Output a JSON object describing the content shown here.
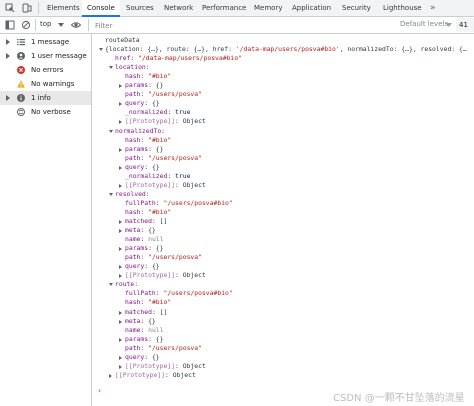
{
  "tabs": [
    {
      "label": "Elements"
    },
    {
      "label": "Console"
    },
    {
      "label": "Sources"
    },
    {
      "label": "Network"
    },
    {
      "label": "Performance"
    },
    {
      "label": "Memory"
    },
    {
      "label": "Application"
    },
    {
      "label": "Security"
    },
    {
      "label": "Lighthouse"
    }
  ],
  "active_tab": "Console",
  "more_tabs": "»",
  "toolbar": {
    "context": "top",
    "filter_placeholder": "Filter",
    "levels": "Default levels",
    "issues_count": "41"
  },
  "sidebar": {
    "items": [
      {
        "label": "1 message",
        "icon": "list-icon"
      },
      {
        "label": "1 user message",
        "icon": "user-icon"
      },
      {
        "label": "No errors",
        "icon": "error-icon"
      },
      {
        "label": "No warnings",
        "icon": "warning-icon"
      },
      {
        "label": "1 info",
        "icon": "info-icon"
      },
      {
        "label": "No verbose",
        "icon": "verbose-icon"
      }
    ],
    "selected_index": 4
  },
  "console": {
    "lines": [
      {
        "indent": 0,
        "tri": "",
        "text": [
          [
            "p",
            "routeData"
          ]
        ]
      },
      {
        "indent": 0,
        "tri": "down",
        "text": [
          [
            "p",
            "{location: {…}, route: {…}, href: "
          ],
          [
            "s",
            "'/data-map/users/posva#bio'"
          ],
          [
            "p",
            ", normalizedTo: {…}, resolved: {…"
          ]
        ]
      },
      {
        "indent": 1,
        "tri": "",
        "text": [
          [
            "k",
            "href"
          ],
          [
            "p",
            ": "
          ],
          [
            "s",
            "\"/data-map/users/posva#bio\""
          ]
        ]
      },
      {
        "indent": 1,
        "tri": "down",
        "text": [
          [
            "k",
            "location"
          ],
          [
            "p",
            ":"
          ]
        ]
      },
      {
        "indent": 2,
        "tri": "",
        "text": [
          [
            "k",
            "hash"
          ],
          [
            "p",
            ": "
          ],
          [
            "s",
            "\"#bio\""
          ]
        ]
      },
      {
        "indent": 2,
        "tri": "right",
        "text": [
          [
            "k",
            "params"
          ],
          [
            "p",
            ": {}"
          ]
        ]
      },
      {
        "indent": 2,
        "tri": "",
        "text": [
          [
            "k",
            "path"
          ],
          [
            "p",
            ": "
          ],
          [
            "s",
            "\"/users/posva\""
          ]
        ]
      },
      {
        "indent": 2,
        "tri": "right",
        "text": [
          [
            "k",
            "query"
          ],
          [
            "p",
            ": {}"
          ]
        ]
      },
      {
        "indent": 2,
        "tri": "",
        "text": [
          [
            "k",
            "_normalized"
          ],
          [
            "p",
            ": "
          ],
          [
            "n",
            "true"
          ]
        ]
      },
      {
        "indent": 2,
        "tri": "right",
        "text": [
          [
            "k dim",
            "[[Prototype]]"
          ],
          [
            "p",
            ": Object"
          ]
        ]
      },
      {
        "indent": 1,
        "tri": "down",
        "text": [
          [
            "k",
            "normalizedTo"
          ],
          [
            "p",
            ":"
          ]
        ]
      },
      {
        "indent": 2,
        "tri": "",
        "text": [
          [
            "k",
            "hash"
          ],
          [
            "p",
            ": "
          ],
          [
            "s",
            "\"#bio\""
          ]
        ]
      },
      {
        "indent": 2,
        "tri": "right",
        "text": [
          [
            "k",
            "params"
          ],
          [
            "p",
            ": {}"
          ]
        ]
      },
      {
        "indent": 2,
        "tri": "",
        "text": [
          [
            "k",
            "path"
          ],
          [
            "p",
            ": "
          ],
          [
            "s",
            "\"/users/posva\""
          ]
        ]
      },
      {
        "indent": 2,
        "tri": "right",
        "text": [
          [
            "k",
            "query"
          ],
          [
            "p",
            ": {}"
          ]
        ]
      },
      {
        "indent": 2,
        "tri": "",
        "text": [
          [
            "k",
            "_normalized"
          ],
          [
            "p",
            ": "
          ],
          [
            "n",
            "true"
          ]
        ]
      },
      {
        "indent": 2,
        "tri": "right",
        "text": [
          [
            "k dim",
            "[[Prototype]]"
          ],
          [
            "p",
            ": Object"
          ]
        ]
      },
      {
        "indent": 1,
        "tri": "down",
        "text": [
          [
            "k",
            "resolved"
          ],
          [
            "p",
            ":"
          ]
        ]
      },
      {
        "indent": 2,
        "tri": "",
        "text": [
          [
            "k",
            "fullPath"
          ],
          [
            "p",
            ": "
          ],
          [
            "s",
            "\"/users/posva#bio\""
          ]
        ]
      },
      {
        "indent": 2,
        "tri": "",
        "text": [
          [
            "k",
            "hash"
          ],
          [
            "p",
            ": "
          ],
          [
            "s",
            "\"#bio\""
          ]
        ]
      },
      {
        "indent": 2,
        "tri": "right",
        "text": [
          [
            "k",
            "matched"
          ],
          [
            "p",
            ": []"
          ]
        ]
      },
      {
        "indent": 2,
        "tri": "right",
        "text": [
          [
            "k",
            "meta"
          ],
          [
            "p",
            ": {}"
          ]
        ]
      },
      {
        "indent": 2,
        "tri": "",
        "text": [
          [
            "k",
            "name"
          ],
          [
            "p",
            ": "
          ],
          [
            "nul",
            "null"
          ]
        ]
      },
      {
        "indent": 2,
        "tri": "right",
        "text": [
          [
            "k",
            "params"
          ],
          [
            "p",
            ": {}"
          ]
        ]
      },
      {
        "indent": 2,
        "tri": "",
        "text": [
          [
            "k",
            "path"
          ],
          [
            "p",
            ": "
          ],
          [
            "s",
            "\"/users/posva\""
          ]
        ]
      },
      {
        "indent": 2,
        "tri": "right",
        "text": [
          [
            "k",
            "query"
          ],
          [
            "p",
            ": {}"
          ]
        ]
      },
      {
        "indent": 2,
        "tri": "right",
        "text": [
          [
            "k dim",
            "[[Prototype]]"
          ],
          [
            "p",
            ": Object"
          ]
        ]
      },
      {
        "indent": 1,
        "tri": "down",
        "text": [
          [
            "k",
            "route"
          ],
          [
            "p",
            ":"
          ]
        ]
      },
      {
        "indent": 2,
        "tri": "",
        "text": [
          [
            "k",
            "fullPath"
          ],
          [
            "p",
            ": "
          ],
          [
            "s",
            "\"/users/posva#bio\""
          ]
        ]
      },
      {
        "indent": 2,
        "tri": "",
        "text": [
          [
            "k",
            "hash"
          ],
          [
            "p",
            ": "
          ],
          [
            "s",
            "\"#bio\""
          ]
        ]
      },
      {
        "indent": 2,
        "tri": "right",
        "text": [
          [
            "k",
            "matched"
          ],
          [
            "p",
            ": []"
          ]
        ]
      },
      {
        "indent": 2,
        "tri": "right",
        "text": [
          [
            "k",
            "meta"
          ],
          [
            "p",
            ": {}"
          ]
        ]
      },
      {
        "indent": 2,
        "tri": "",
        "text": [
          [
            "k",
            "name"
          ],
          [
            "p",
            ": "
          ],
          [
            "nul",
            "null"
          ]
        ]
      },
      {
        "indent": 2,
        "tri": "right",
        "text": [
          [
            "k",
            "params"
          ],
          [
            "p",
            ": {}"
          ]
        ]
      },
      {
        "indent": 2,
        "tri": "",
        "text": [
          [
            "k",
            "path"
          ],
          [
            "p",
            ": "
          ],
          [
            "s",
            "\"/users/posva\""
          ]
        ]
      },
      {
        "indent": 2,
        "tri": "right",
        "text": [
          [
            "k",
            "query"
          ],
          [
            "p",
            ": {}"
          ]
        ]
      },
      {
        "indent": 2,
        "tri": "right",
        "text": [
          [
            "k dim",
            "[[Prototype]]"
          ],
          [
            "p",
            ": Object"
          ]
        ]
      },
      {
        "indent": 1,
        "tri": "right",
        "text": [
          [
            "k dim",
            "[[Prototype]]"
          ],
          [
            "p",
            ": Object"
          ]
        ]
      }
    ],
    "prompt": "›"
  },
  "watermark": "CSDN @一颗不甘坠落的流星",
  "colors": {
    "accent": "#1a73e8",
    "key": "#881391",
    "string": "#c41a16",
    "boolean": "#0d22aa",
    "null": "#80868b",
    "error": "#d93025",
    "warning": "#f2a600",
    "info": "#5f6368"
  }
}
